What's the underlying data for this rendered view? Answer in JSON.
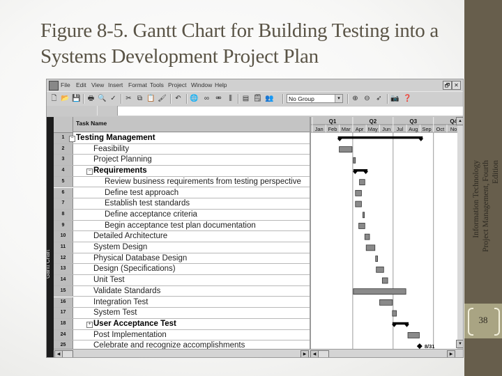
{
  "slide": {
    "title_line1": "Figure 8-5. Gantt Chart for Building Testing into a",
    "title_line2": "Systems Development Project Plan",
    "sidebar_caption_line1": "Information Technology",
    "sidebar_caption_line2": "Project Management, Fourth",
    "sidebar_caption_line3": "Edition",
    "page_number": "38"
  },
  "app": {
    "menu": [
      "File",
      "Edit",
      "View",
      "Insert",
      "Format",
      "Tools",
      "Project",
      "Window",
      "Help"
    ],
    "window_buttons": {
      "restore": "🗗",
      "close": "✕"
    },
    "toolbar_icons": [
      "new-icon",
      "open-icon",
      "save-icon",
      "print-icon",
      "print-preview-icon",
      "spelling-icon",
      "cut-icon",
      "copy-icon",
      "paste-icon",
      "format-painter-icon",
      "undo-icon",
      "hyperlink-icon",
      "link-tasks-icon",
      "unlink-tasks-icon",
      "split-task-icon",
      "task-info-icon",
      "notes-icon",
      "assign-resources-icon",
      "zoom-in-icon",
      "zoom-out-icon",
      "goto-task-icon",
      "copy-picture-icon",
      "help-icon"
    ],
    "group_select": {
      "value": "No Group",
      "arrow": "▾"
    },
    "view_bar_label": "Gantt Chart",
    "table_header": {
      "task_name": "Task Name"
    }
  },
  "chart_data": {
    "type": "gantt",
    "title": "Figure 8-5. Gantt Chart for Building Testing into a Systems Development Project Plan",
    "timescale": {
      "quarters": [
        "Q1",
        "Q2",
        "Q3",
        "Q4"
      ],
      "months": [
        "Jan",
        "Feb",
        "Mar",
        "Apr",
        "May",
        "Jun",
        "Jul",
        "Aug",
        "Sep",
        "Oct",
        "No"
      ],
      "unit": "months from Jan 1",
      "range": [
        0,
        11
      ]
    },
    "quarter_gridlines": [
      3,
      6,
      9
    ],
    "tasks": [
      {
        "id": "1",
        "name": "Testing Management",
        "level": 0,
        "kind": "summary",
        "toggle": "minus",
        "start": 1.9,
        "end": 8.2
      },
      {
        "id": "2",
        "name": "Feasibility",
        "level": 1,
        "kind": "task",
        "start": 2.0,
        "end": 2.95
      },
      {
        "id": "3",
        "name": "Project Planning",
        "level": 1,
        "kind": "task",
        "start": 3.05,
        "end": 3.2
      },
      {
        "id": "4",
        "name": "Requirements",
        "level": 1,
        "kind": "summary",
        "toggle": "minus",
        "start": 3.05,
        "end": 4.1
      },
      {
        "id": "5",
        "name": "Review business requirements from testing perspective",
        "level": 2,
        "kind": "task",
        "start": 3.5,
        "end": 3.9
      },
      {
        "id": "6",
        "name": "Define test approach",
        "level": 2,
        "kind": "task",
        "start": 3.2,
        "end": 3.65
      },
      {
        "id": "7",
        "name": "Establish test standards",
        "level": 2,
        "kind": "task",
        "start": 3.2,
        "end": 3.65
      },
      {
        "id": "8",
        "name": "Define acceptance criteria",
        "level": 2,
        "kind": "task",
        "start": 3.75,
        "end": 3.87
      },
      {
        "id": "9",
        "name": "Begin acceptance test plan documentation",
        "level": 2,
        "kind": "task",
        "start": 3.45,
        "end": 3.9
      },
      {
        "id": "10",
        "name": "Detailed Architecture",
        "level": 1,
        "kind": "task",
        "start": 3.9,
        "end": 4.25
      },
      {
        "id": "11",
        "name": "System Design",
        "level": 1,
        "kind": "task",
        "start": 4.0,
        "end": 4.65
      },
      {
        "id": "12",
        "name": "Physical Database Design",
        "level": 1,
        "kind": "task",
        "start": 4.7,
        "end": 4.85
      },
      {
        "id": "13",
        "name": "Design (Specifications)",
        "level": 1,
        "kind": "task",
        "start": 4.75,
        "end": 5.3
      },
      {
        "id": "14",
        "name": "Unit Test",
        "level": 1,
        "kind": "task",
        "start": 5.2,
        "end": 5.6
      },
      {
        "id": "15",
        "name": "Validate Standards",
        "level": 1,
        "kind": "task",
        "start": 3.05,
        "end": 6.95
      },
      {
        "id": "16",
        "name": "Integration Test",
        "level": 1,
        "kind": "task",
        "start": 5.0,
        "end": 5.95
      },
      {
        "id": "17",
        "name": "System Test",
        "level": 1,
        "kind": "task",
        "start": 5.95,
        "end": 6.25
      },
      {
        "id": "18",
        "name": "User Acceptance Test",
        "level": 1,
        "kind": "summary",
        "toggle": "plus",
        "start": 5.95,
        "end": 7.15
      },
      {
        "id": "24",
        "name": "Post Implementation",
        "level": 1,
        "kind": "task",
        "start": 7.1,
        "end": 7.95
      },
      {
        "id": "25",
        "name": "Celebrate and recognize accomplishments",
        "level": 1,
        "kind": "milestone",
        "start": 7.97,
        "end": 7.97,
        "label": "8/31"
      }
    ],
    "colors": {
      "task_bar": "#8a8a8a",
      "task_border": "#333333",
      "summary": "#000000",
      "milestone": "#000000",
      "gridline": "#9a9a9a"
    }
  }
}
